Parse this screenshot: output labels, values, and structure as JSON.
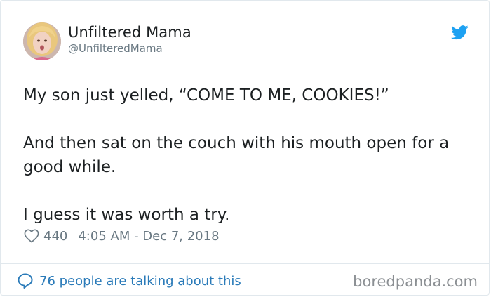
{
  "author": {
    "display_name": "Unfiltered Mama",
    "handle": "@UnfilteredMama",
    "avatar_icon": "profile-photo"
  },
  "brand": {
    "bird_icon": "twitter-bird-icon",
    "bird_color": "#1da1f2"
  },
  "tweet": {
    "paragraphs": [
      "My son just yelled, “COME TO ME, COOKIES!”",
      "And then sat on the couch with his mouth open for a good while.",
      "I guess it was worth a try."
    ]
  },
  "meta": {
    "like_icon": "heart-icon",
    "like_count": "440",
    "timestamp": "4:05 AM - Dec 7, 2018"
  },
  "footer": {
    "conversation_icon": "speech-bubble-icon",
    "conversation_text": "76 people are talking about this",
    "link_color": "#2b7bb9"
  },
  "watermark": {
    "text": "boredpanda.com"
  }
}
